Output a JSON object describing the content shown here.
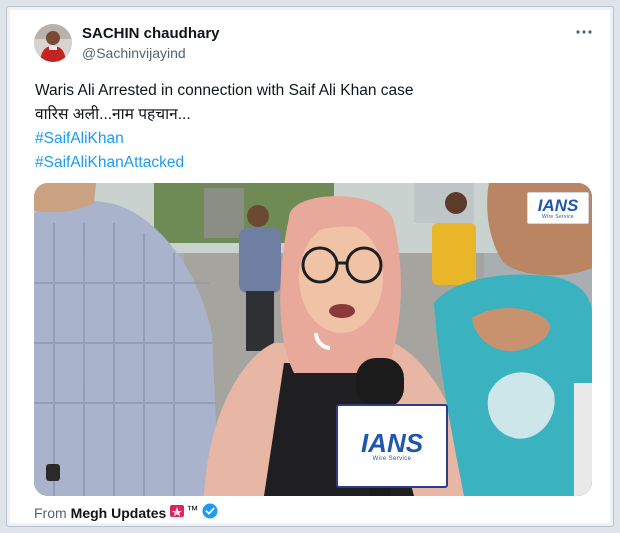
{
  "post": {
    "display_name": "SACHIN chaudhary",
    "handle": "@Sachinvijayind",
    "text_line1": "Waris Ali Arrested in connection with Saif Ali Khan case",
    "text_line2": "वारिस अली...नाम पहचान...",
    "hashtags": [
      "#SaifAliKhan",
      "#SaifAliKhanAttacked"
    ],
    "more_icon": "more-horizontal-icon"
  },
  "media": {
    "watermark_main": "IANS",
    "watermark_sub": "Wire Service",
    "mic_main": "IANS",
    "mic_sub": "Wire Service"
  },
  "footer": {
    "from_label": "From",
    "source_name": "Megh Updates",
    "trademark": "™",
    "flag_icon": "red-flag-emoji-icon",
    "verified_icon": "verified-badge-icon"
  },
  "colors": {
    "link": "#1d9bf0",
    "text": "#0f1419",
    "muted": "#536471",
    "verified": "#1d9bf0"
  }
}
